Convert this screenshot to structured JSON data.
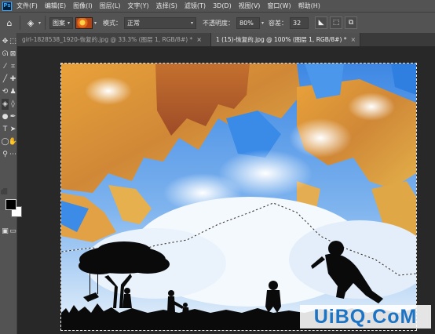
{
  "app": {
    "logo": "Ps"
  },
  "menu": [
    "文件(F)",
    "编辑(E)",
    "图像(I)",
    "图层(L)",
    "文字(Y)",
    "选择(S)",
    "滤镜(T)",
    "3D(D)",
    "视图(V)",
    "窗口(W)",
    "帮助(H)"
  ],
  "options": {
    "fill_source": "图案",
    "mode_label": "模式：",
    "mode_value": "正常",
    "opacity_label": "不透明度：",
    "opacity_value": "80%",
    "tolerance_label": "容差：",
    "tolerance_value": "32"
  },
  "tabs": [
    {
      "label": "girl-1828538_1920-恢复的.jpg @ 33.3% (图层 1, RGB/8#) *",
      "active": false
    },
    {
      "label": "1 (15)-恢复的.jpg @ 100% (图层 1, RGB/8#) *",
      "active": true
    }
  ],
  "tools": [
    "move-tool",
    "marquee-tool",
    "lasso-tool",
    "quick-selection-tool",
    "eyedropper-tool",
    "crop-tool",
    "brush-tool",
    "healing-brush-tool",
    "history-brush-tool",
    "clone-stamp-tool",
    "paint-bucket-tool",
    "eraser-tool",
    "dodge-tool",
    "pen-tool",
    "type-tool",
    "path-selection-tool",
    "ellipse-tool",
    "hand-tool",
    "zoom-tool",
    "more-tools"
  ],
  "colors": {
    "foreground": "#000000",
    "background": "#ffffff",
    "accent": "#31a8ff"
  },
  "watermark": "UiBQ.CoM"
}
